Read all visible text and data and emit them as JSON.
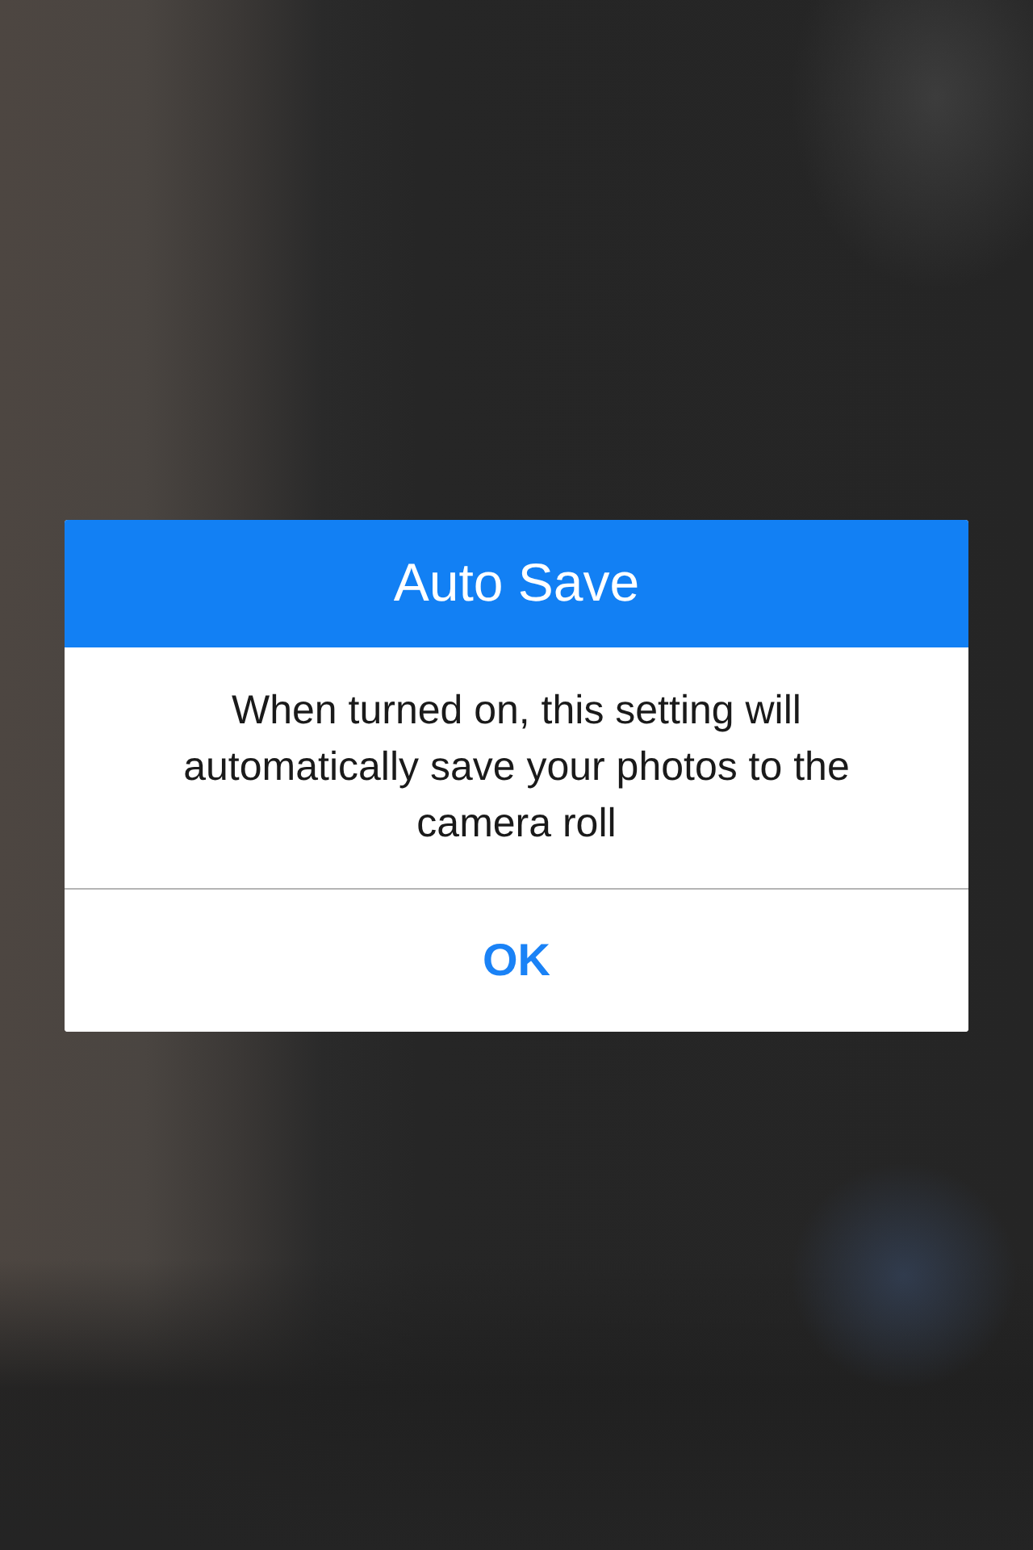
{
  "alert": {
    "title": "Auto Save",
    "message": "When turned on, this setting will automatically save your photos to the camera roll",
    "buttons": [
      {
        "label": "OK"
      }
    ]
  }
}
